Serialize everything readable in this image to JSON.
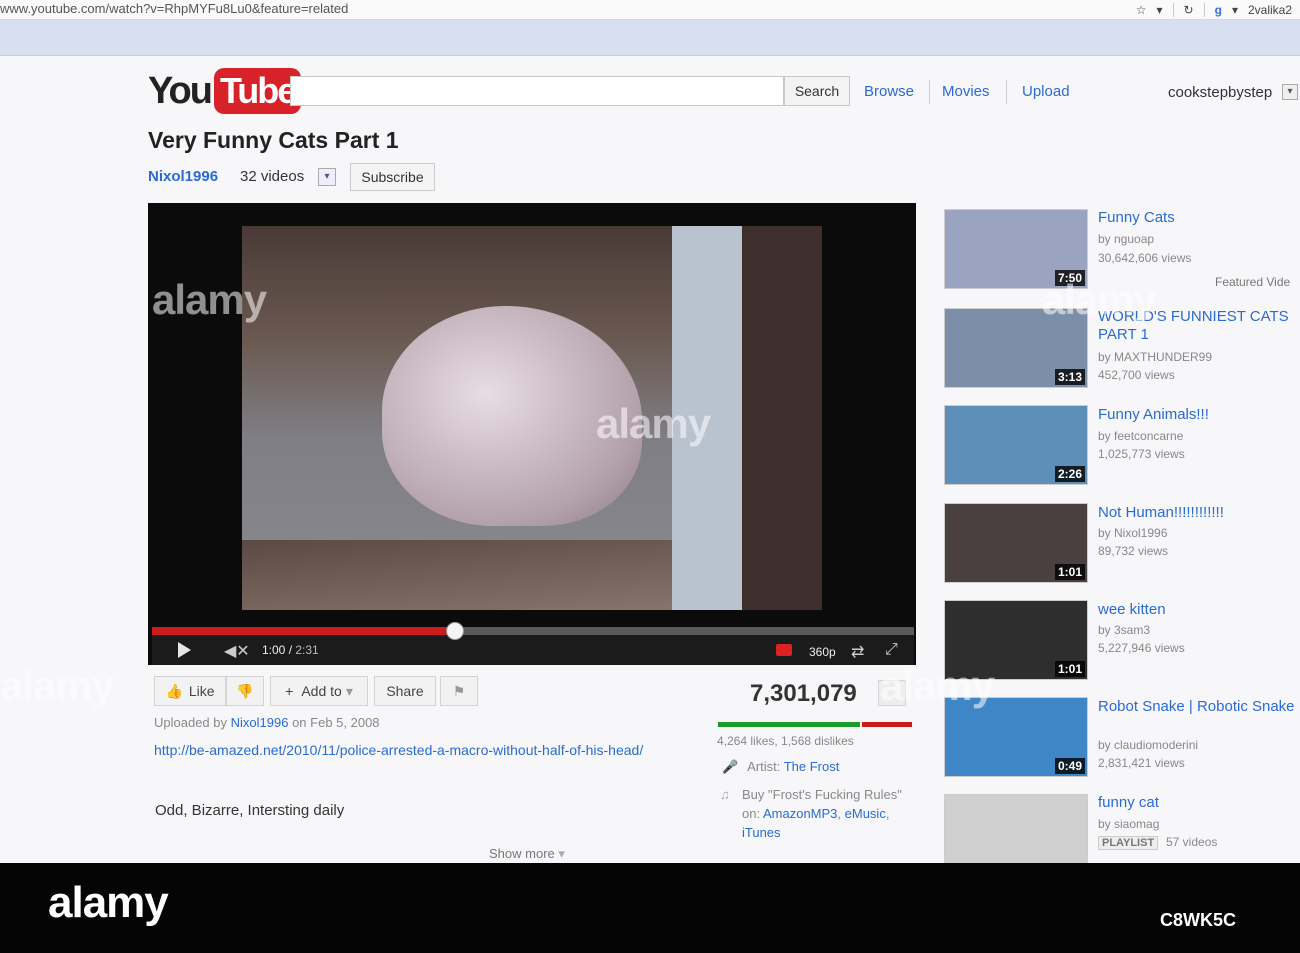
{
  "browser": {
    "url": "www.youtube.com/watch?v=RhpMYFu8Lu0&feature=related",
    "profile": "2valika2"
  },
  "header": {
    "logo_you": "You",
    "logo_tube": "Tube",
    "search_button": "Search",
    "nav": [
      "Browse",
      "Movies",
      "Upload"
    ],
    "username": "cookstepbystep"
  },
  "video": {
    "title": "Very Funny Cats Part 1",
    "channel": "Nixol1996",
    "channel_videos": "32 videos",
    "subscribe": "Subscribe",
    "time_current": "1:00",
    "time_total": "2:31",
    "progress": 0.397,
    "quality": "360p"
  },
  "actions": {
    "like": "Like",
    "add_to": "Add to",
    "share": "Share"
  },
  "stats": {
    "views": "7,301,079",
    "likes_dislikes": "4,264 likes, 1,568 dislikes",
    "like_ratio": 0.731
  },
  "description": {
    "uploaded_prefix": "Uploaded by",
    "uploader": "Nixol1996",
    "uploaded_suffix": "on Feb 5, 2008",
    "link": "http://be-amazed.net/2010/11/police-arrested-a-macro-without-half-of-his-head/",
    "text": "Odd, Bizarre, Intersting daily",
    "show_more": "Show more"
  },
  "music": {
    "artist_label": "Artist:",
    "artist": "The Frost",
    "buy_text": "Buy \"Frost's Fucking Rules\" on:",
    "stores": [
      "AmazonMP3",
      "eMusic",
      "iTunes"
    ]
  },
  "related": [
    {
      "title": "Funny Cats",
      "by": "by nguoap",
      "views": "30,642,606 views",
      "duration": "7:50",
      "thumb": "#9aa4c0"
    },
    {
      "title": "WORLD'S FUNNIEST CATS PART 1",
      "by": "by MAXTHUNDER99",
      "views": "452,700 views",
      "duration": "3:13",
      "thumb": "#7d8fa8"
    },
    {
      "title": "Funny Animals!!!",
      "by": "by feetconcarne",
      "views": "1,025,773 views",
      "duration": "2:26",
      "thumb": "#5d8fb8"
    },
    {
      "title": "Not Human!!!!!!!!!!!!",
      "by": "by Nixol1996",
      "views": "89,732 views",
      "duration": "1:01",
      "thumb": "#4a4040"
    },
    {
      "title": "wee kitten",
      "by": "by 3sam3",
      "views": "5,227,946 views",
      "duration": "1:01",
      "thumb": "#2e2e2e"
    },
    {
      "title": "Robot Snake | Robotic Snake",
      "by": "by claudiomoderini",
      "views": "2,831,421 views",
      "duration": "0:49",
      "thumb": "#3e86c6"
    },
    {
      "title": "funny cat",
      "by": "by siaomag",
      "views": "",
      "duration": "",
      "thumb": "#cfcfcf"
    }
  ],
  "featured_label": "Featured Vide",
  "playlist": {
    "badge": "PLAYLIST",
    "count": "57 videos"
  },
  "watermark": {
    "logo": "alamy",
    "id": "C8WK5C"
  }
}
